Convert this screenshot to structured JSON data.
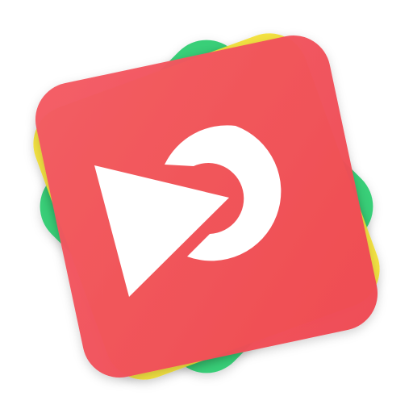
{
  "icon": {
    "name": "app-icon",
    "glyph": "play-arrow-with-ring",
    "colors": {
      "back_layer": "#2ecc71",
      "middle_layer": "#f3e23a",
      "front_layer": "#ef4852",
      "front_layer_highlight": "#f35a63",
      "glyph": "#ffffff"
    }
  }
}
